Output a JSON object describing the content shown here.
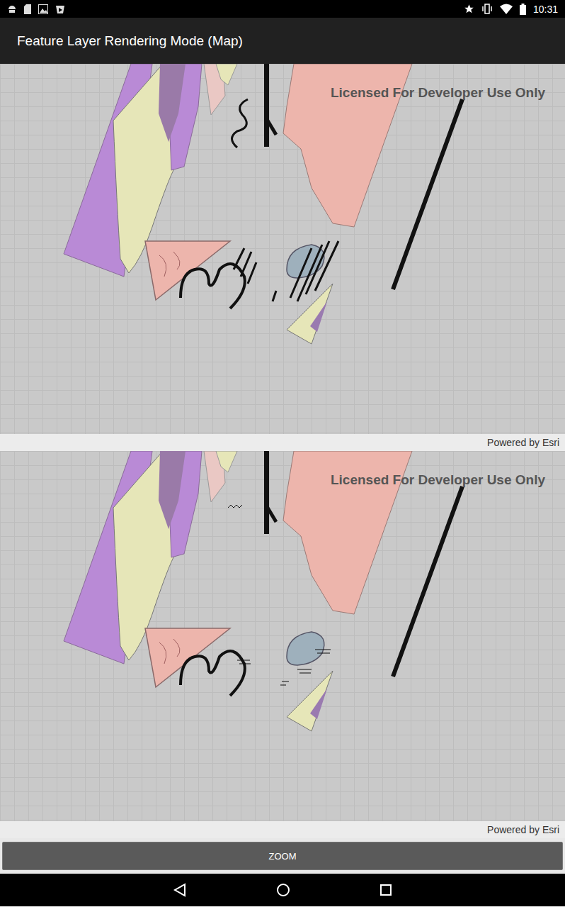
{
  "status_bar": {
    "time": "10:31"
  },
  "app_bar": {
    "title": "Feature Layer Rendering Mode (Map)"
  },
  "maps": [
    {
      "watermark": "Licensed For Developer Use Only",
      "attribution": "Powered by Esri",
      "kind": "dynamic"
    },
    {
      "watermark": "Licensed For Developer Use Only",
      "attribution": "Powered by Esri",
      "kind": "static"
    }
  ],
  "button": {
    "label": "ZOOM"
  }
}
